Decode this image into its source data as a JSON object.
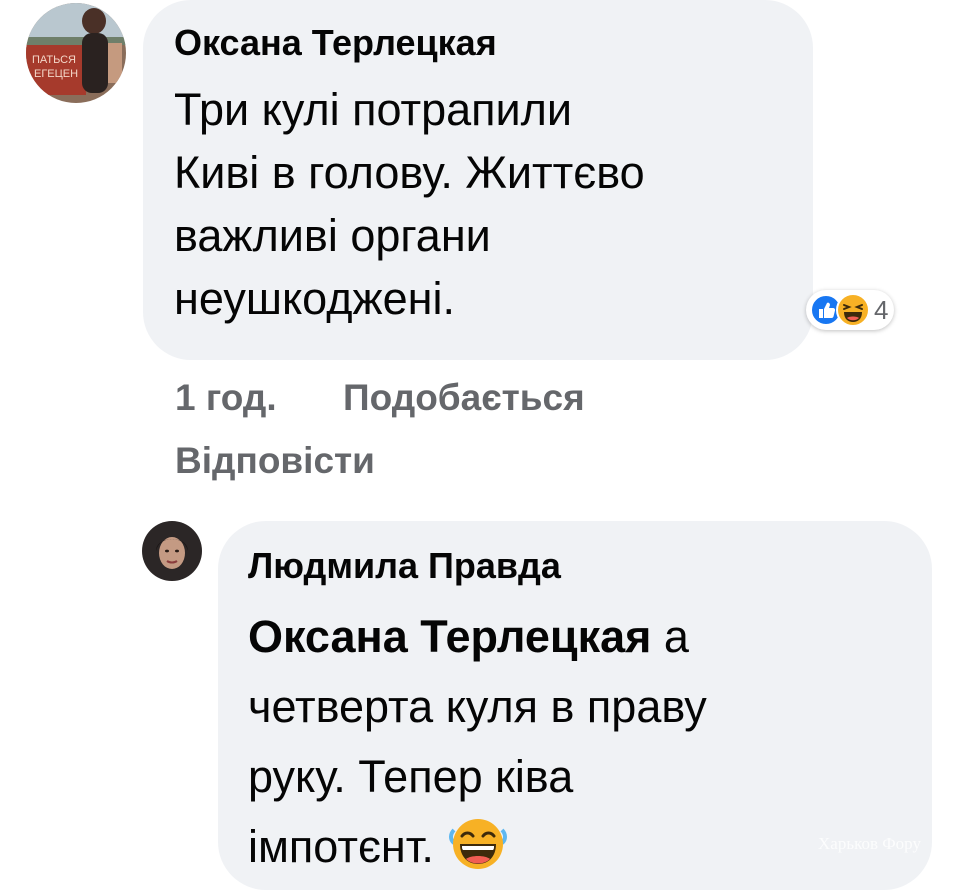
{
  "comments": [
    {
      "author": "Оксана Терлецкая",
      "avatar_icon": "profile-photo",
      "text_lines": [
        "Три кулі потрапили",
        "Киві в голову. Життєво",
        "важливі органи",
        "неушкоджені."
      ],
      "reactions": {
        "icons": [
          "like-icon",
          "haha-icon"
        ],
        "count": "4"
      },
      "time": "1 год.",
      "like_label": "Подобається",
      "reply_label": "Відповісти"
    },
    {
      "author": "Людмила Правда",
      "avatar_icon": "profile-photo",
      "mention": "Оксана Терлецкая",
      "text_lines": [
        " а",
        "четверта куля в праву",
        "руку. Тепер ківа",
        "імпотєнт."
      ],
      "emoji": "haha-icon"
    }
  ],
  "watermark": "Харьков Фору",
  "colors": {
    "bubble": "#f0f2f5",
    "meta": "#65676b",
    "like_blue": "#1877f2",
    "haha_yellow": "#f7b125"
  }
}
